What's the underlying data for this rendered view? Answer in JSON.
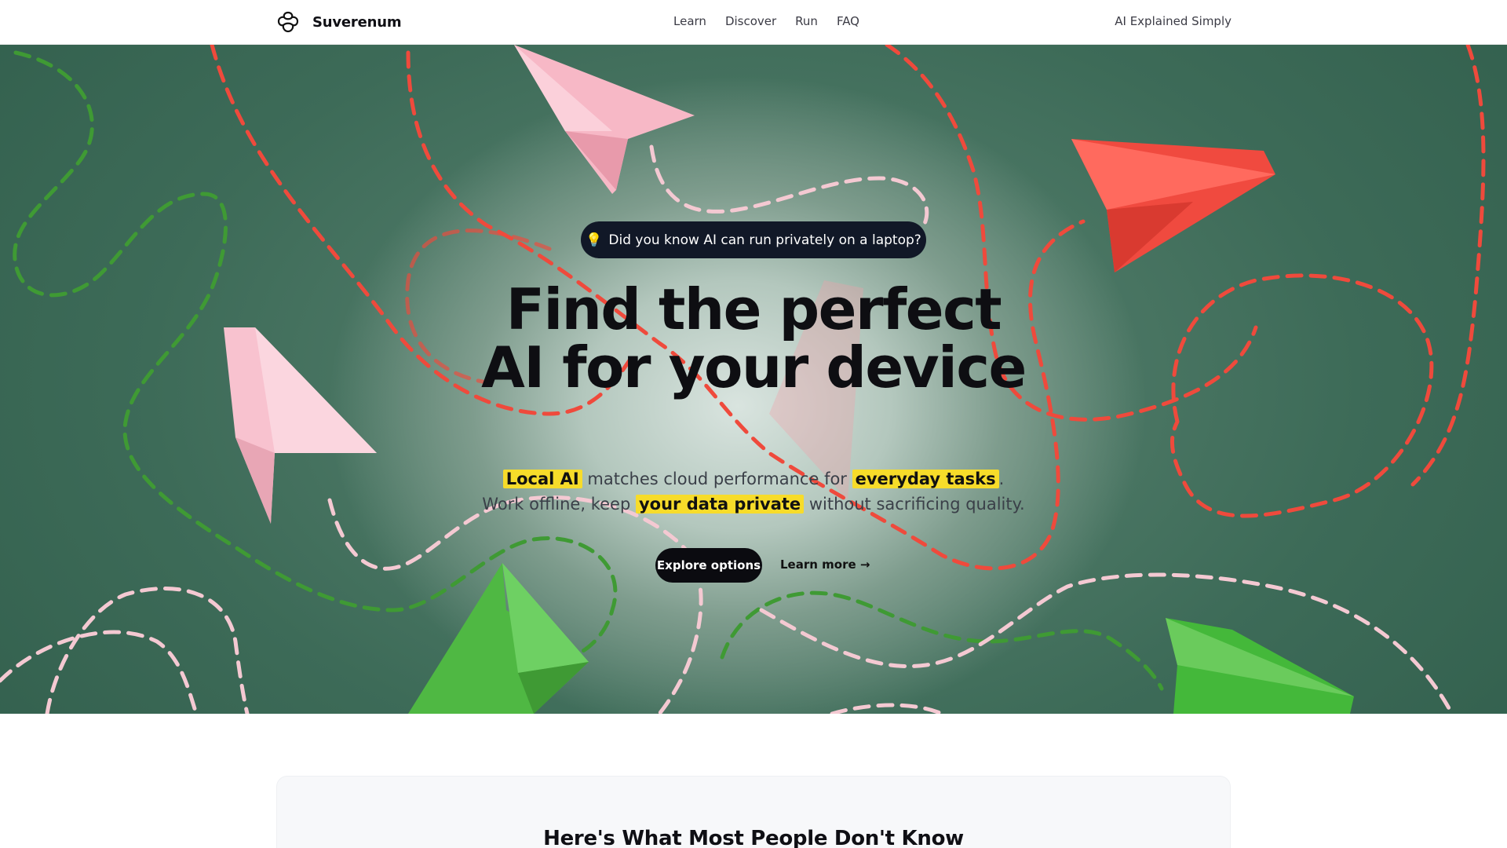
{
  "nav": {
    "brand": "Suverenum",
    "links": [
      "Learn",
      "Discover",
      "Run",
      "FAQ"
    ],
    "right_text": "AI Explained Simply"
  },
  "hero": {
    "pill_icon": "💡",
    "pill_text": "Did you know AI can run privately on a laptop?",
    "headline_line1": "Find the perfect",
    "headline_line2": "AI for your device",
    "sub": {
      "hl1": "Local AI",
      "t1": " matches cloud performance for ",
      "hl2": "everyday tasks",
      "t2": ".",
      "t3": "Work offline, keep ",
      "hl3": "your data private",
      "t4": " without sacrificing quality."
    },
    "cta_primary": "Explore options",
    "cta_secondary": "Learn more →"
  },
  "section": {
    "title": "Here's What Most People Don't Know"
  },
  "colors": {
    "highlight": "#f7dc2a",
    "dark": "#0b0b10",
    "hero_green": "#3d6b58",
    "path_red": "#ef4a3c",
    "path_green": "#3f9a34",
    "path_pink": "#f4c9d2"
  },
  "icons": {
    "brand": "brand-knot-icon",
    "pill": "lightbulb-icon"
  }
}
